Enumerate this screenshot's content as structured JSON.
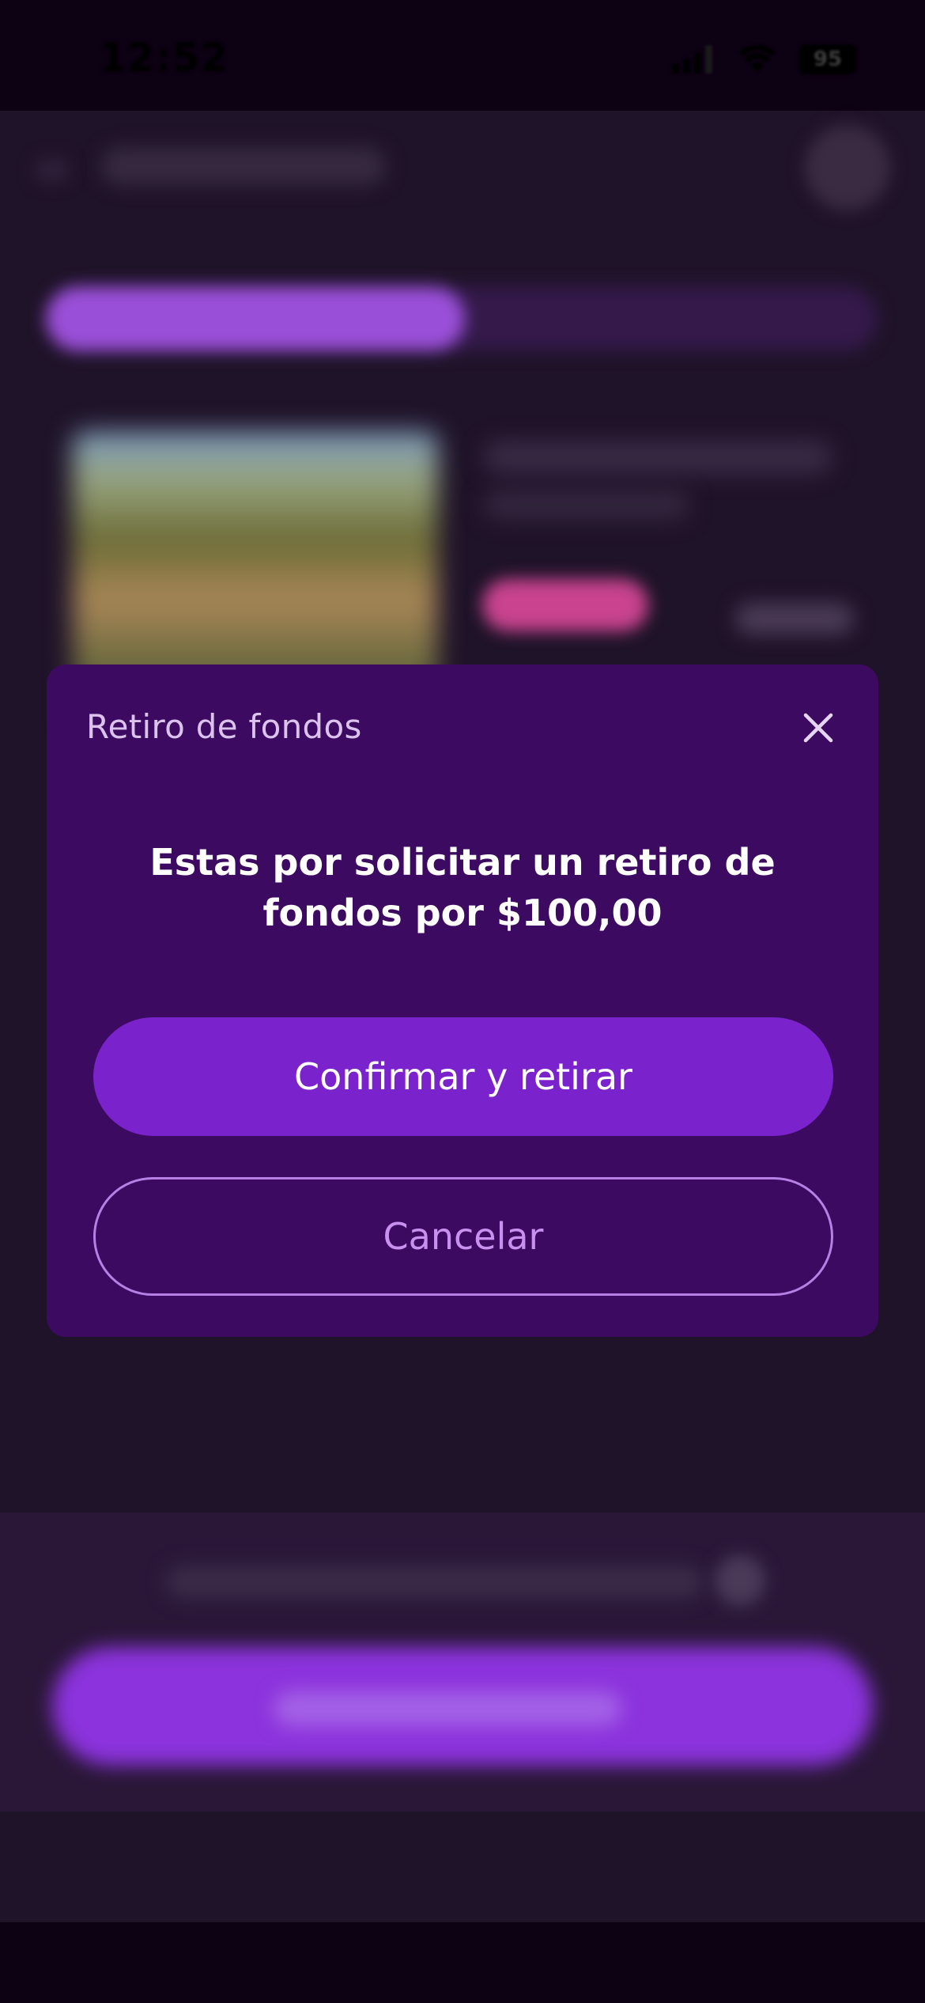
{
  "status_bar": {
    "time": "12:52",
    "battery": "95",
    "icons": [
      "cellular-signal-icon",
      "wifi-icon",
      "battery-icon"
    ]
  },
  "modal": {
    "title": "Retiro de fondos",
    "close_icon": "close-icon",
    "message": "Estas por solicitar un retiro de fondos por $100,00",
    "confirm_label": "Confirmar y retirar",
    "cancel_label": "Cancelar"
  },
  "colors": {
    "modal_background": "#3c0a60",
    "primary_button": "#7a22cc",
    "secondary_outline": "#b680e4",
    "page_background": "#1f1329"
  }
}
